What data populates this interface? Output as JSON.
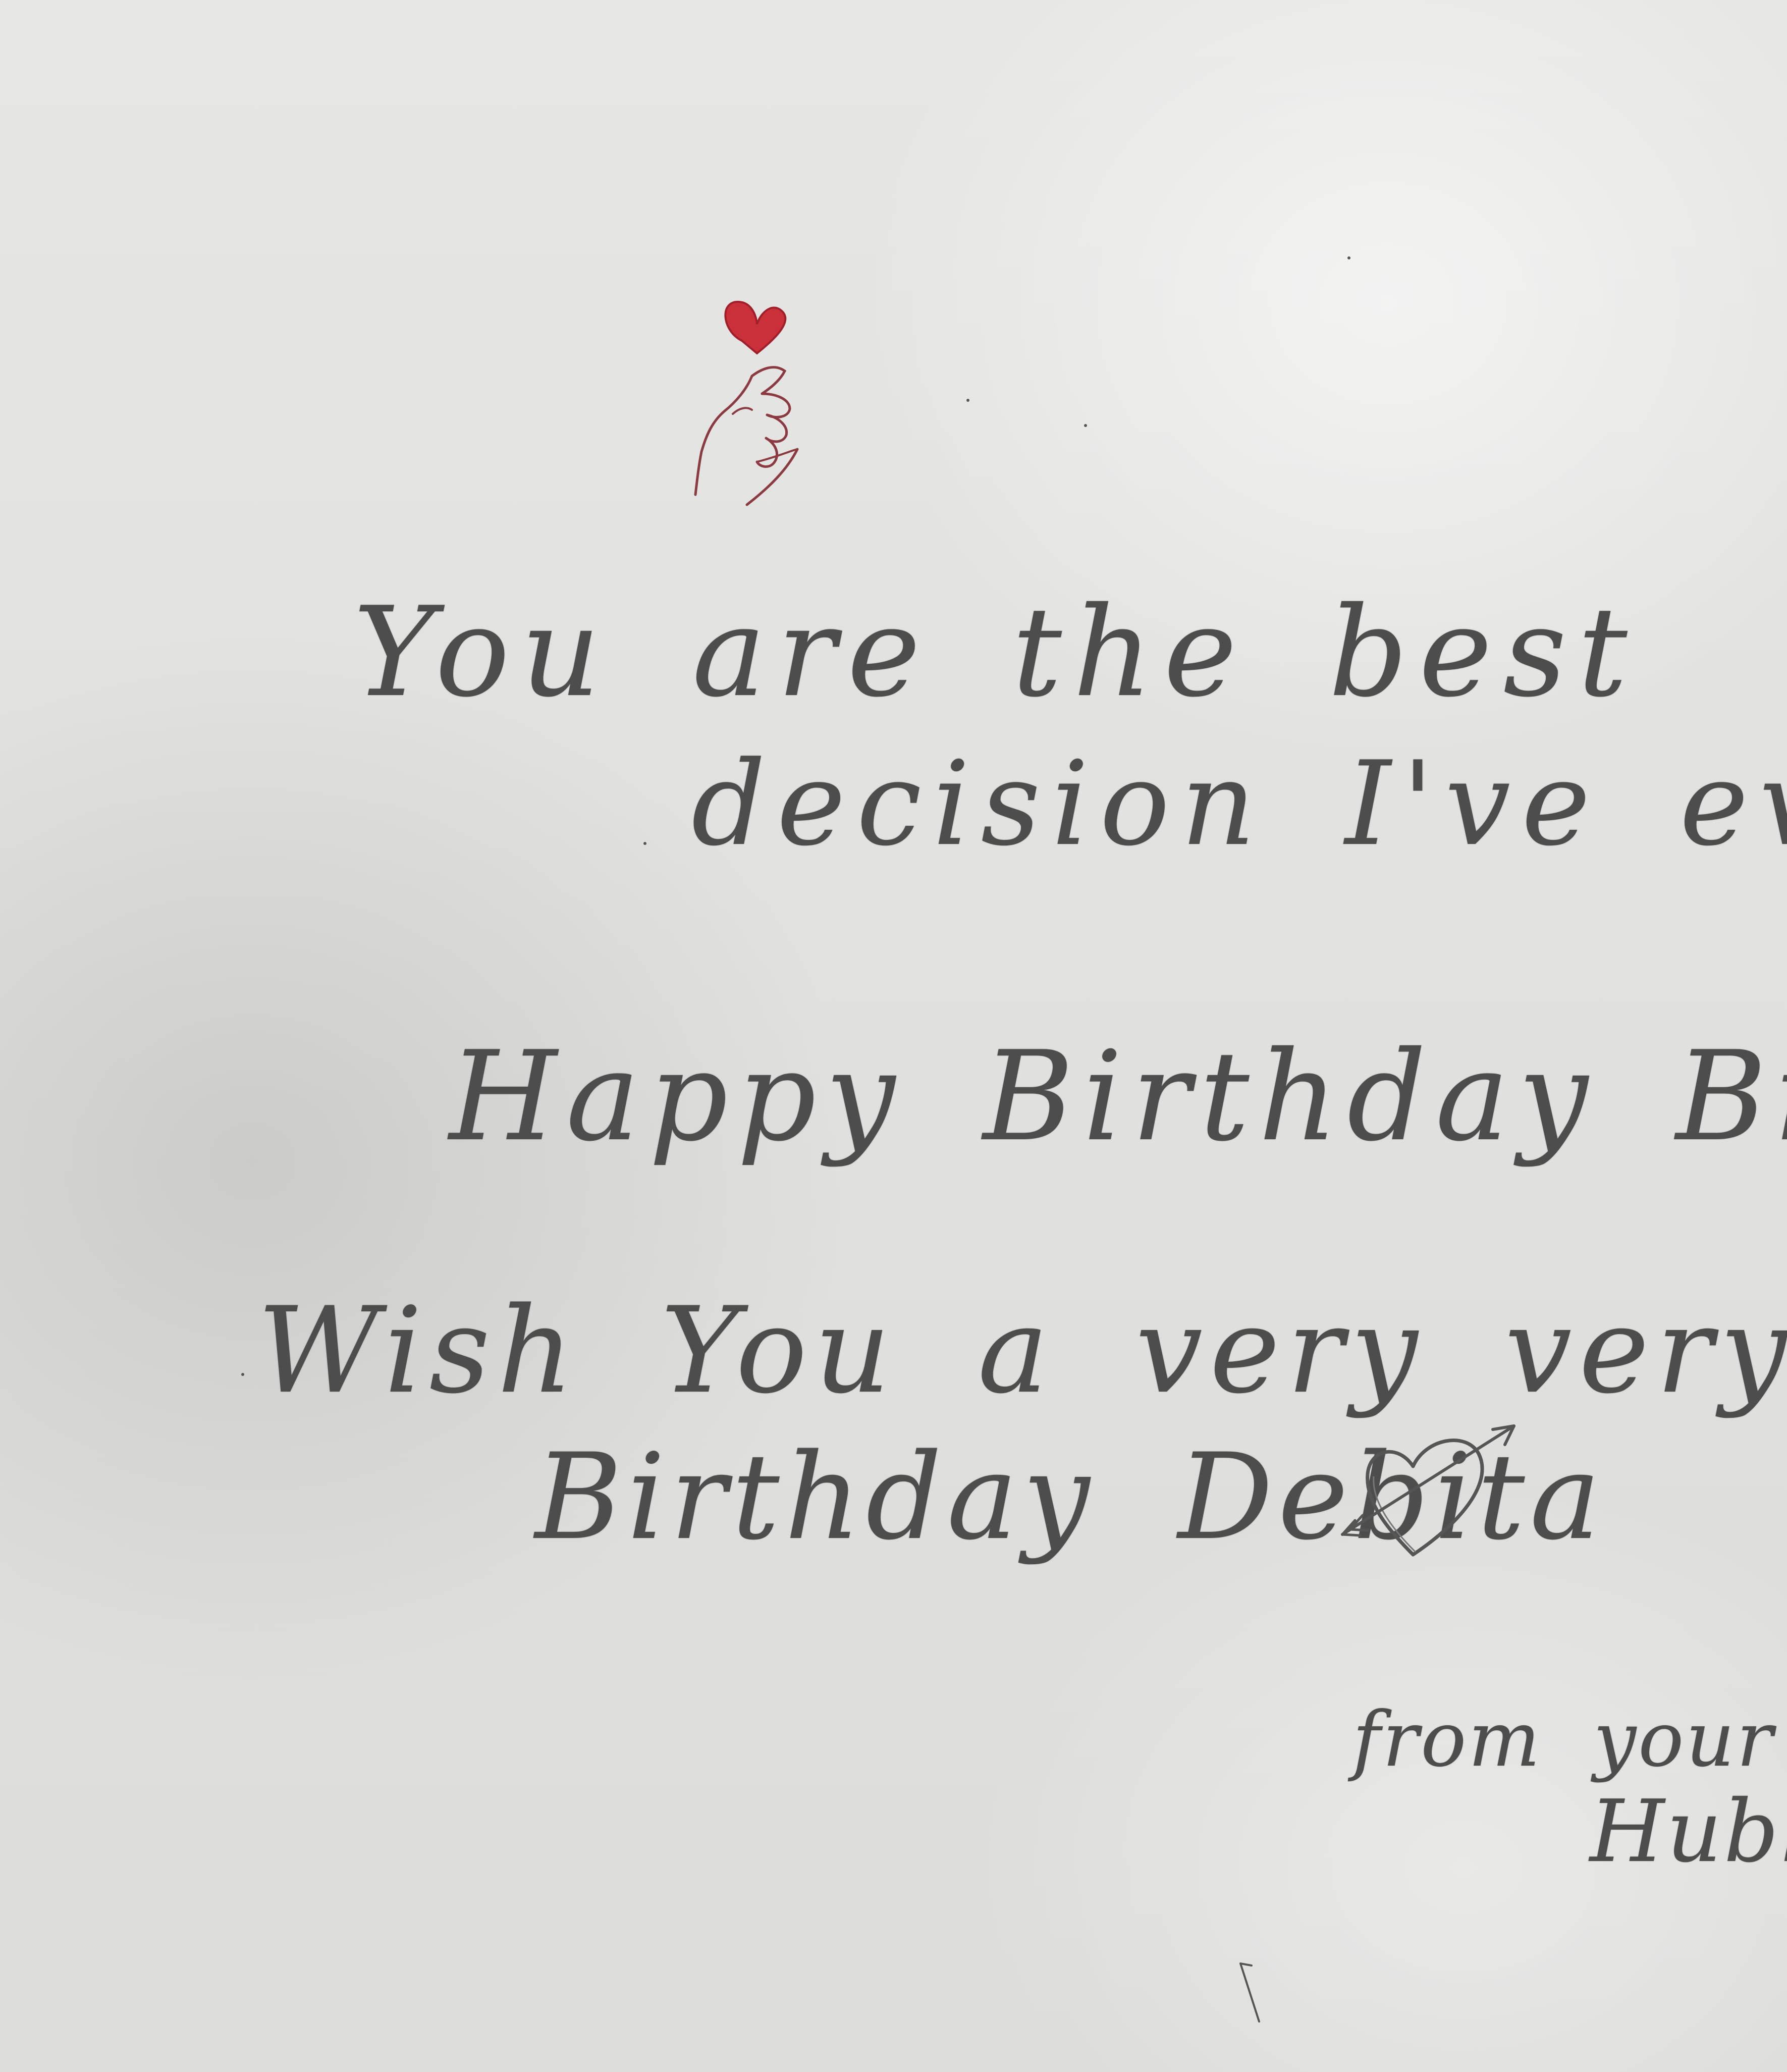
{
  "note": {
    "line1": "You are the best",
    "line2": "decision I've ever made",
    "line3": "Happy Birthday Bii !!!",
    "line4": "Wish You a very very Happy",
    "line5": "Birthday Debita",
    "signature_line1": "from your",
    "signature_line2": "Hubby"
  },
  "illustrations": {
    "top": "finger-heart-icon",
    "bottom": "heart-arrow-icon"
  },
  "colors": {
    "paper": "#e3e3e1",
    "pencil": "#4d4d4d",
    "heart_red": "#c9303a"
  }
}
